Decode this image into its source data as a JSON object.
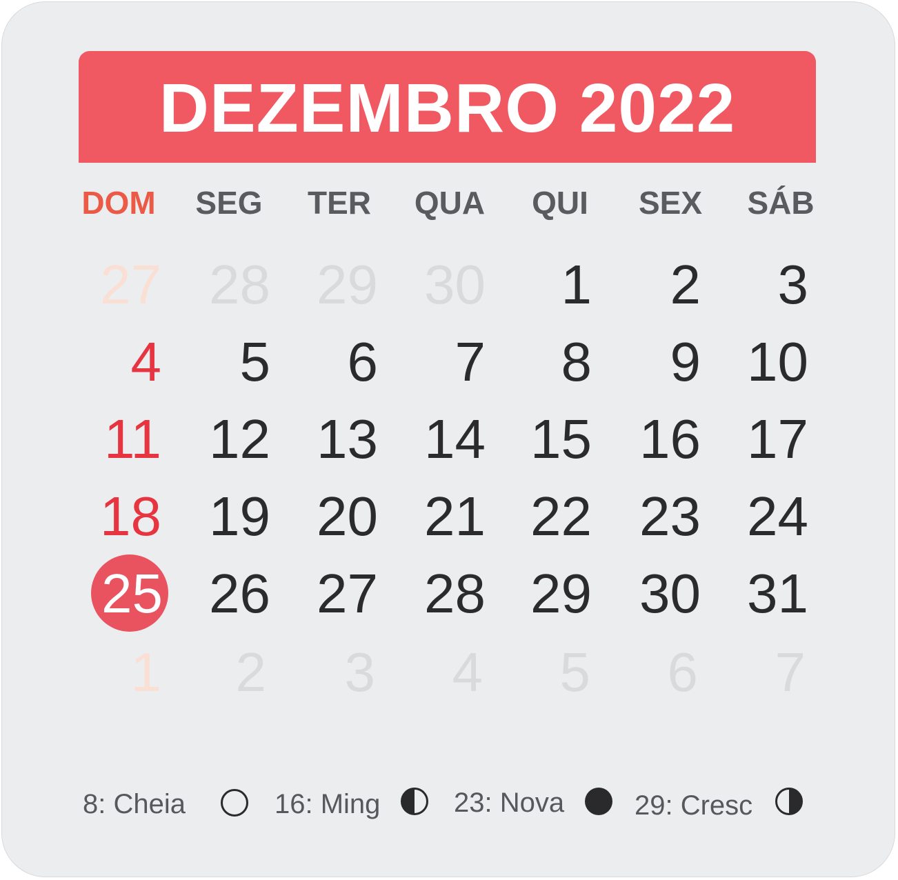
{
  "title": "DEZEMBRO 2022",
  "weekdays": [
    "DOM",
    "SEG",
    "TER",
    "QUA",
    "QUI",
    "SEX",
    "SÁB"
  ],
  "weeks": [
    [
      "27",
      "28",
      "29",
      "30",
      "1",
      "2",
      "3"
    ],
    [
      "4",
      "5",
      "6",
      "7",
      "8",
      "9",
      "10"
    ],
    [
      "11",
      "12",
      "13",
      "14",
      "15",
      "16",
      "17"
    ],
    [
      "18",
      "19",
      "20",
      "21",
      "22",
      "23",
      "24"
    ],
    [
      "25",
      "26",
      "27",
      "28",
      "29",
      "30",
      "31"
    ],
    [
      "1",
      "2",
      "3",
      "4",
      "5",
      "6",
      "7"
    ]
  ],
  "highlighted_day": "25",
  "moon_phases": [
    {
      "label": "8: Cheia",
      "icon": "full-moon-icon"
    },
    {
      "label": "16: Ming",
      "icon": "waning-moon-icon"
    },
    {
      "label": "23: Nova",
      "icon": "new-moon-icon"
    },
    {
      "label": "29: Cresc",
      "icon": "waxing-moon-icon"
    }
  ],
  "colors": {
    "header": "#f05862",
    "sunday": "#e63440",
    "highlight": "#e9525f",
    "text": "#2b2b2d",
    "faded": "#d9dadc"
  }
}
